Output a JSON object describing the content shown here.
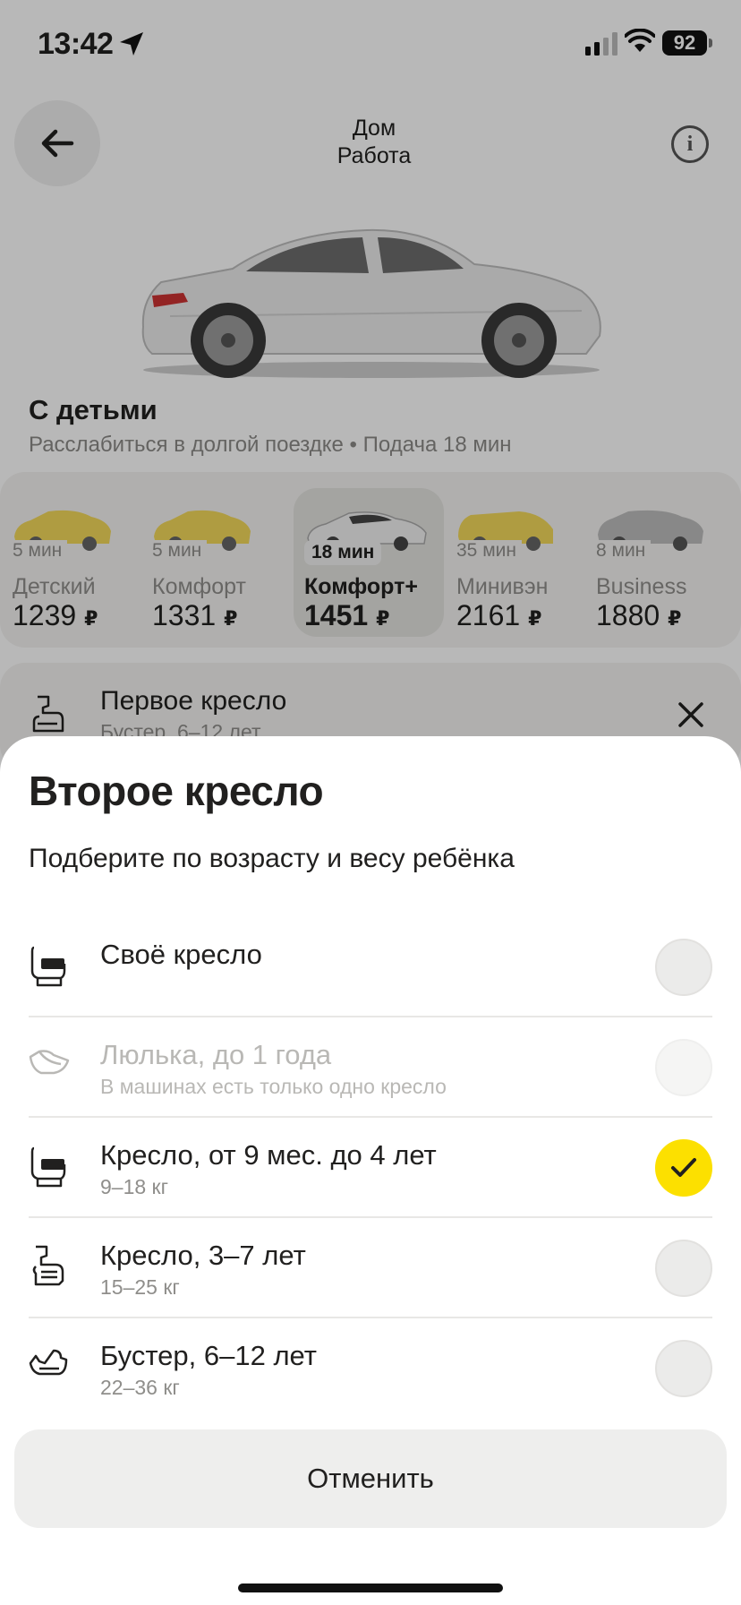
{
  "status_bar": {
    "time": "13:42",
    "battery": "92"
  },
  "header": {
    "route_from": "Дом",
    "route_to": "Работа"
  },
  "tariff": {
    "name": "С детьми",
    "subtitle": "Расслабиться в долгой поездке • Подача 18 мин"
  },
  "tariff_cards": [
    {
      "eta": "5 мин",
      "name": "Детский",
      "price": "1239",
      "selected": false
    },
    {
      "eta": "5 мин",
      "name": "Комфорт",
      "price": "1331",
      "selected": false
    },
    {
      "eta": "18 мин",
      "name": "Комфорт+",
      "price": "1451",
      "selected": true
    },
    {
      "eta": "35 мин",
      "name": "Минивэн",
      "price": "2161",
      "selected": false
    },
    {
      "eta": "8 мин",
      "name": "Business",
      "price": "1880",
      "selected": false
    }
  ],
  "currency": "₽",
  "first_seat": {
    "title": "Первое кресло",
    "subtitle": "Бустер, 6–12 лет"
  },
  "sheet": {
    "title": "Второе кресло",
    "subtitle": "Подберите по возрасту и весу ребёнка",
    "options": [
      {
        "title": "Своё кресло",
        "subtitle": "",
        "selected": false,
        "disabled": false,
        "icon": "car-seat-icon"
      },
      {
        "title": "Люлька, до 1 года",
        "subtitle": "В машинах есть только одно кресло",
        "selected": false,
        "disabled": true,
        "icon": "baby-cradle-icon"
      },
      {
        "title": "Кресло, от 9 мес. до 4 лет",
        "subtitle": "9–18 кг",
        "selected": true,
        "disabled": false,
        "icon": "car-seat-icon"
      },
      {
        "title": "Кресло, 3–7 лет",
        "subtitle": "15–25 кг",
        "selected": false,
        "disabled": false,
        "icon": "child-seat-icon"
      },
      {
        "title": "Бустер, 6–12 лет",
        "subtitle": "22–36 кг",
        "selected": false,
        "disabled": false,
        "icon": "booster-seat-icon"
      }
    ],
    "cancel_label": "Отменить"
  },
  "colors": {
    "accent": "#fce000",
    "text": "#21201f",
    "secondary": "#8f8e8b",
    "overlay": "rgba(0,0,0,0.28)"
  }
}
